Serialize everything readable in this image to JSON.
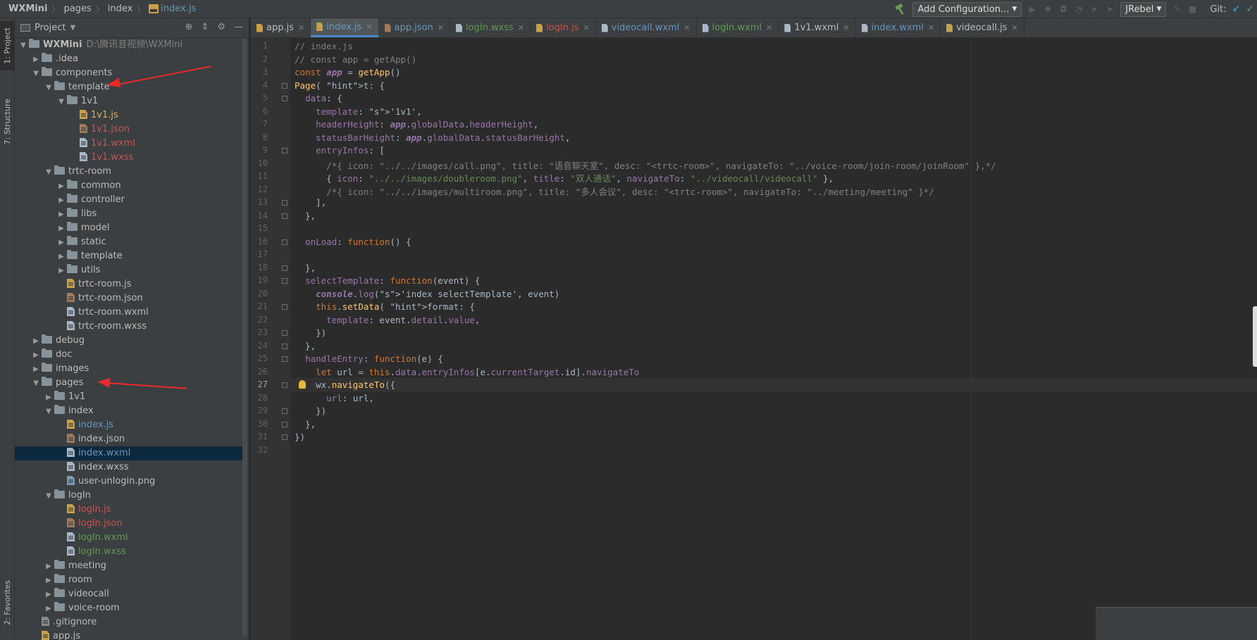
{
  "breadcrumb": {
    "root": "WXMini",
    "seg1": "pages",
    "seg2": "index",
    "current": "index.js"
  },
  "toolbar": {
    "add_config": "Add Configuration...",
    "jrebel": "JRebel",
    "git": "Git:"
  },
  "side_tabs": {
    "project": "1: Project",
    "structure": "7: Structure",
    "favorites": "2: Favorites"
  },
  "project_panel": {
    "title": "Project",
    "root_name": "WXMini",
    "root_path": "D:\\腾讯音视频\\WXMini",
    "items": [
      {
        "label": ".idea",
        "kind": "folder",
        "depth": 1,
        "expanded": false,
        "color": "default"
      },
      {
        "label": "components",
        "kind": "folder",
        "depth": 1,
        "expanded": true,
        "color": "default"
      },
      {
        "label": "template",
        "kind": "folder",
        "depth": 2,
        "expanded": true,
        "color": "default"
      },
      {
        "label": "1v1",
        "kind": "folder",
        "depth": 3,
        "expanded": true,
        "color": "default"
      },
      {
        "label": "1v1.js",
        "kind": "js",
        "depth": 4,
        "color": "orange"
      },
      {
        "label": "1v1.json",
        "kind": "json",
        "depth": 4,
        "color": "red"
      },
      {
        "label": "1v1.wxml",
        "kind": "wx",
        "depth": 4,
        "color": "red"
      },
      {
        "label": "1v1.wxss",
        "kind": "wx",
        "depth": 4,
        "color": "red"
      },
      {
        "label": "trtc-room",
        "kind": "folder",
        "depth": 2,
        "expanded": true,
        "color": "default"
      },
      {
        "label": "common",
        "kind": "folder",
        "depth": 3,
        "expanded": false,
        "color": "default"
      },
      {
        "label": "controller",
        "kind": "folder",
        "depth": 3,
        "expanded": false,
        "color": "default"
      },
      {
        "label": "libs",
        "kind": "folder",
        "depth": 3,
        "expanded": false,
        "color": "default"
      },
      {
        "label": "model",
        "kind": "folder",
        "depth": 3,
        "expanded": false,
        "color": "default"
      },
      {
        "label": "static",
        "kind": "folder",
        "depth": 3,
        "expanded": false,
        "color": "default"
      },
      {
        "label": "template",
        "kind": "folder",
        "depth": 3,
        "expanded": false,
        "color": "default"
      },
      {
        "label": "utils",
        "kind": "folder",
        "depth": 3,
        "expanded": false,
        "color": "default"
      },
      {
        "label": "trtc-room.js",
        "kind": "js",
        "depth": 3,
        "color": "default"
      },
      {
        "label": "trtc-room.json",
        "kind": "json",
        "depth": 3,
        "color": "default"
      },
      {
        "label": "trtc-room.wxml",
        "kind": "wx",
        "depth": 3,
        "color": "default"
      },
      {
        "label": "trtc-room.wxss",
        "kind": "wx",
        "depth": 3,
        "color": "default"
      },
      {
        "label": "debug",
        "kind": "folder",
        "depth": 1,
        "expanded": false,
        "color": "default"
      },
      {
        "label": "doc",
        "kind": "folder",
        "depth": 1,
        "expanded": false,
        "color": "default"
      },
      {
        "label": "images",
        "kind": "folder",
        "depth": 1,
        "expanded": false,
        "color": "default"
      },
      {
        "label": "pages",
        "kind": "folder",
        "depth": 1,
        "expanded": true,
        "color": "default"
      },
      {
        "label": "1v1",
        "kind": "folder",
        "depth": 2,
        "expanded": false,
        "color": "default"
      },
      {
        "label": "index",
        "kind": "folder",
        "depth": 2,
        "expanded": true,
        "color": "default"
      },
      {
        "label": "index.js",
        "kind": "js",
        "depth": 3,
        "color": "blue"
      },
      {
        "label": "index.json",
        "kind": "json",
        "depth": 3,
        "color": "default"
      },
      {
        "label": "index.wxml",
        "kind": "wx",
        "depth": 3,
        "color": "blue",
        "selected": true
      },
      {
        "label": "index.wxss",
        "kind": "wx",
        "depth": 3,
        "color": "default"
      },
      {
        "label": "user-unlogin.png",
        "kind": "png",
        "depth": 3,
        "color": "default"
      },
      {
        "label": "logIn",
        "kind": "folder",
        "depth": 2,
        "expanded": true,
        "color": "default"
      },
      {
        "label": "logIn.js",
        "kind": "js",
        "depth": 3,
        "color": "red"
      },
      {
        "label": "logIn.json",
        "kind": "json",
        "depth": 3,
        "color": "red"
      },
      {
        "label": "logIn.wxml",
        "kind": "wx",
        "depth": 3,
        "color": "green"
      },
      {
        "label": "logIn.wxss",
        "kind": "wx",
        "depth": 3,
        "color": "green"
      },
      {
        "label": "meeting",
        "kind": "folder",
        "depth": 2,
        "expanded": false,
        "color": "default"
      },
      {
        "label": "room",
        "kind": "folder",
        "depth": 2,
        "expanded": false,
        "color": "default"
      },
      {
        "label": "videocall",
        "kind": "folder",
        "depth": 2,
        "expanded": false,
        "color": "default"
      },
      {
        "label": "voice-room",
        "kind": "folder",
        "depth": 2,
        "expanded": false,
        "color": "default"
      },
      {
        "label": ".gitignore",
        "kind": "git",
        "depth": 1,
        "color": "default"
      },
      {
        "label": "app.js",
        "kind": "js",
        "depth": 1,
        "color": "default"
      }
    ]
  },
  "editor_tabs": [
    {
      "label": "app.js",
      "icon": "js",
      "color": "plain",
      "active": false
    },
    {
      "label": "index.js",
      "icon": "js",
      "color": "blue",
      "active": true
    },
    {
      "label": "app.json",
      "icon": "json",
      "color": "blue",
      "active": false
    },
    {
      "label": "logIn.wxss",
      "icon": "wx",
      "color": "green",
      "active": false
    },
    {
      "label": "logIn.js",
      "icon": "js",
      "color": "red",
      "active": false
    },
    {
      "label": "videocall.wxml",
      "icon": "wx",
      "color": "blue",
      "active": false
    },
    {
      "label": "logIn.wxml",
      "icon": "wx",
      "color": "green",
      "active": false
    },
    {
      "label": "1v1.wxml",
      "icon": "wx",
      "color": "plain",
      "active": false
    },
    {
      "label": "index.wxml",
      "icon": "wx",
      "color": "blue",
      "active": false
    },
    {
      "label": "videocall.js",
      "icon": "js",
      "color": "plain",
      "active": false
    }
  ],
  "editor": {
    "current_line": 27,
    "lines": [
      "// index.js",
      "// const app = getApp()",
      "const app = getApp()",
      "Page( t: {",
      "  data: {",
      "    template: '1v1',",
      "    headerHeight: app.globalData.headerHeight,",
      "    statusBarHeight: app.globalData.statusBarHeight,",
      "    entryInfos: [",
      "      /*{ icon: \"../../images/call.png\", title: \"语音聊天室\", desc: \"<trtc-room>\", navigateTo: \"../voice-room/join-room/joinRoom\" },*/",
      "      { icon: \"../../images/doubleroom.png\", title: \"双人通话\", navigateTo: \"../videocall/videocall\" },",
      "      /*{ icon: \"../../images/multiroom.png\", title: \"多人会议\", desc: \"<trtc-room>\", navigateTo: \"../meeting/meeting\" }*/",
      "    ],",
      "  },",
      "",
      "  onLoad: function() {",
      "",
      "  },",
      "  selectTemplate: function(event) {",
      "    console.log('index selectTemplate', event)",
      "    this.setData( format: {",
      "      template: event.detail.value,",
      "    })",
      "  },",
      "  handleEntry: function(e) {",
      "    let url = this.data.entryInfos[e.currentTarget.id].navigateTo",
      "    wx.navigateTo({",
      "      url: url,",
      "    })",
      "  },",
      "})",
      ""
    ]
  },
  "colors": {
    "keyword": "#cc7832",
    "string": "#6a8759",
    "comment": "#808080",
    "function": "#ffc66d",
    "property": "#9876aa",
    "annotation_arrow": "#e82a2a",
    "selection": "#0d293e"
  },
  "icons": {
    "project": "project-icon",
    "locate": "crosshair-icon",
    "collapse": "collapse-icon",
    "settings": "gear-icon",
    "hide": "minus-icon",
    "build": "hammer-icon",
    "lightbulb": "bulb-icon"
  }
}
